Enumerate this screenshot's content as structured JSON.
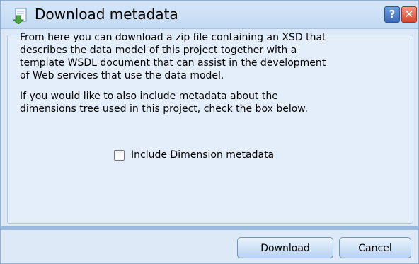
{
  "dialog": {
    "title": "Download metadata",
    "title_icon": "download-metadata-icon",
    "help_label": "?",
    "close_label": "✕"
  },
  "content": {
    "paragraph1": "From here you can download a zip file containing an XSD that\ndescribes the data model of this project together with a\ntemplate WSDL document that can assist in the development\nof Web services that use the data model.",
    "paragraph2": "If you would like to also include metadata about the\ndimensions tree used in this project, check the box below.",
    "checkbox_label": "Include Dimension metadata",
    "checkbox_checked": false
  },
  "buttons": {
    "download": "Download",
    "cancel": "Cancel"
  },
  "colors": {
    "background": "#dde9f7",
    "panel": "#e4eefa",
    "border": "#a7c3e6",
    "help": "#3a69bb",
    "close": "#d6452a"
  }
}
